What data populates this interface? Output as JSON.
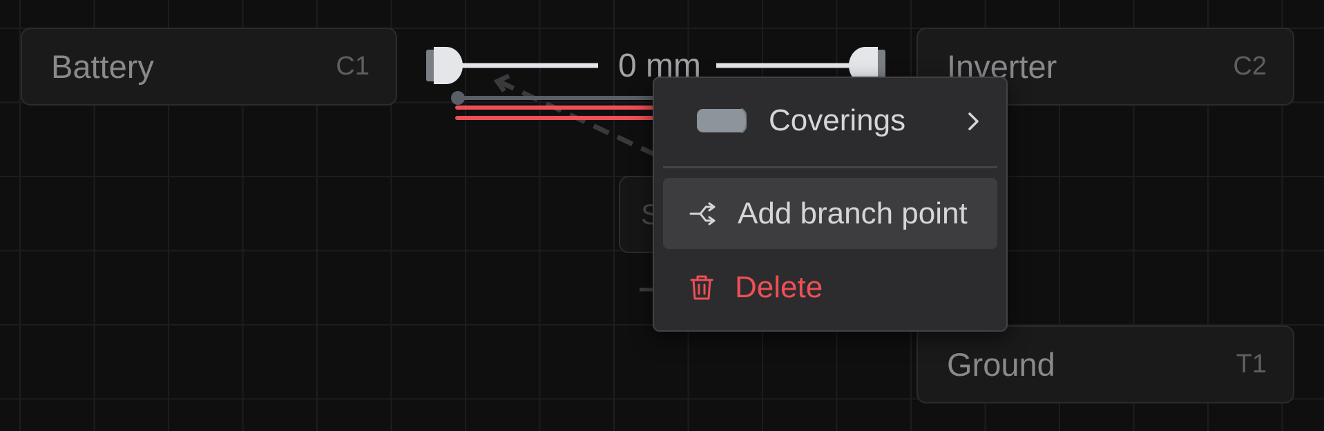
{
  "nodes": {
    "battery": {
      "name": "Battery",
      "ref": "C1"
    },
    "inverter": {
      "name": "Inverter",
      "ref": "C2"
    },
    "ground": {
      "name": "Ground",
      "ref": "T1"
    },
    "splice": {
      "name_partial": "S"
    }
  },
  "wire": {
    "length_label": "0 mm"
  },
  "context_menu": {
    "items": [
      {
        "label": "Coverings",
        "icon": "covering-swatch-icon",
        "has_submenu": true
      },
      {
        "label": "Add branch point",
        "icon": "branch-point-icon",
        "highlighted": true
      },
      {
        "label": "Delete",
        "icon": "trash-icon",
        "destructive": true
      }
    ]
  },
  "colors": {
    "canvas_bg": "#0f0f10",
    "wire_red": "#ef4f55",
    "wire_white": "#e4e6ea",
    "wire_gray": "#5a5e66",
    "menu_bg": "#2c2c2e",
    "menu_highlight": "#3d3d40",
    "delete_red": "#ef4f55",
    "covering_swatch": "#8e949b"
  }
}
